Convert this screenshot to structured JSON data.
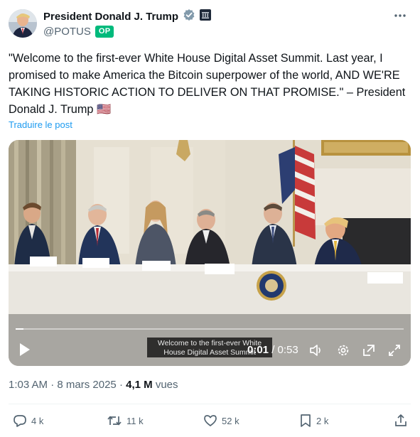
{
  "author": {
    "display_name": "President Donald J. Trump",
    "handle": "@POTUS",
    "badge": "OP"
  },
  "post": {
    "text": "\"Welcome to the first-ever White House Digital Asset Summit. Last year, I promised to make America the Bitcoin superpower of the world, AND WE'RE TAKING HISTORIC ACTION TO DELIVER ON THAT PROMISE.\" – President Donald J. Trump 🇺🇸",
    "translate_label": "Traduire le post"
  },
  "video": {
    "caption": "Welcome to the first-ever White House Digital Asset Summit",
    "current_time": "0:01",
    "duration": "0:53",
    "progress": 0.02
  },
  "meta": {
    "time": "1:03 AM",
    "separator": "·",
    "date": "8 mars 2025",
    "views_count": "4,1 M",
    "views_label": "vues"
  },
  "actions": {
    "replies": "4 k",
    "reposts": "11 k",
    "likes": "52 k",
    "bookmarks": "2 k"
  },
  "colors": {
    "accent": "#1d9bf0",
    "op_badge": "#00ba7c",
    "muted_text": "#536471"
  }
}
